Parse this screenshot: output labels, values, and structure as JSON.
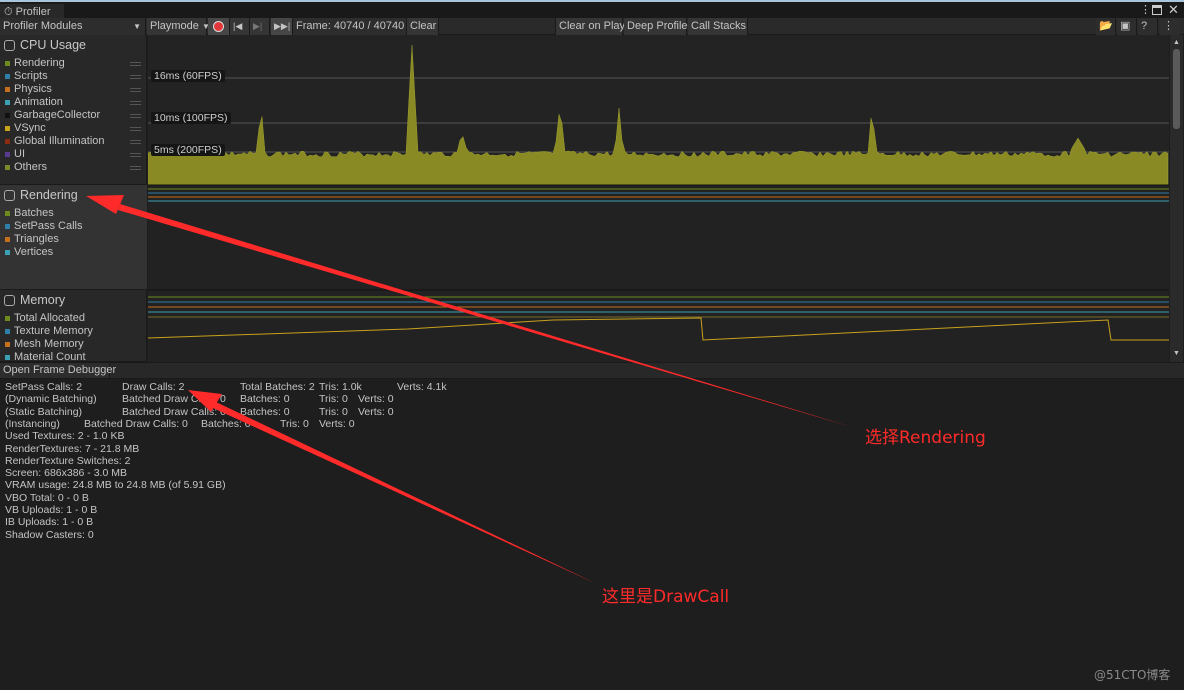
{
  "window": {
    "tab": "Profiler",
    "menu_icon": "kebab-icon",
    "maximize_icon": "maximize-icon",
    "close_icon": "close-icon"
  },
  "toolbar": {
    "modules": "Profiler Modules",
    "target": "Playmode",
    "frame": "Frame: 40740 / 40740",
    "clear": "Clear",
    "clear_on_play": "Clear on Play",
    "deep_profile": "Deep Profile",
    "call_stacks": "Call Stacks"
  },
  "modules": [
    {
      "title": "CPU Usage",
      "items": [
        {
          "label": "Rendering",
          "color": "#6e8a1c"
        },
        {
          "label": "Scripts",
          "color": "#2f7fa8"
        },
        {
          "label": "Physics",
          "color": "#c6701f"
        },
        {
          "label": "Animation",
          "color": "#3aa0b5"
        },
        {
          "label": "GarbageCollector",
          "color": "#111111"
        },
        {
          "label": "VSync",
          "color": "#c9a21b"
        },
        {
          "label": "Global Illumination",
          "color": "#8a2a10"
        },
        {
          "label": "UI",
          "color": "#5a3a8f"
        },
        {
          "label": "Others",
          "color": "#7a8a2a"
        }
      ]
    },
    {
      "title": "Rendering",
      "items": [
        {
          "label": "Batches",
          "color": "#6e8a1c"
        },
        {
          "label": "SetPass Calls",
          "color": "#2f7fa8"
        },
        {
          "label": "Triangles",
          "color": "#c6701f"
        },
        {
          "label": "Vertices",
          "color": "#3aa0b5"
        }
      ]
    },
    {
      "title": "Memory",
      "items": [
        {
          "label": "Total Allocated",
          "color": "#6e8a1c"
        },
        {
          "label": "Texture Memory",
          "color": "#2f7fa8"
        },
        {
          "label": "Mesh Memory",
          "color": "#c6701f"
        },
        {
          "label": "Material Count",
          "color": "#3aa0b5"
        }
      ]
    }
  ],
  "cpu_chart": {
    "lines": [
      "16ms (60FPS)",
      "10ms (100FPS)",
      "5ms (200FPS)"
    ],
    "fill_color": "#8a8a25"
  },
  "frame_debugger": "Open Frame Debugger",
  "stats": {
    "r1": [
      "SetPass Calls: 2",
      "Draw Calls: 2",
      "Total Batches: 2",
      "Tris: 1.0k",
      "Verts: 4.1k"
    ],
    "r2": [
      "(Dynamic Batching)",
      "Batched Draw Calls: 0",
      "Batches: 0",
      "Tris: 0",
      "Verts: 0"
    ],
    "r3": [
      "(Static Batching)",
      "Batched Draw Calls: 0",
      "Batches: 0",
      "Tris: 0",
      "Verts: 0"
    ],
    "r4": [
      "(Instancing)",
      "Batched Draw Calls: 0",
      "Batches: 0",
      "Tris: 0",
      "Verts: 0"
    ],
    "lines": [
      "Used Textures: 2 - 1.0 KB",
      "RenderTextures: 7 - 21.8 MB",
      "RenderTexture Switches: 2",
      "Screen: 686x386 - 3.0 MB",
      "VRAM usage: 24.8 MB to 24.8 MB (of 5.91 GB)",
      "VBO Total: 0 - 0 B",
      "VB Uploads: 1 - 0 B",
      "IB Uploads: 1 - 0 B",
      "Shadow Casters: 0"
    ]
  },
  "annotations": {
    "a1": "选择Rendering",
    "a2": "这里是DrawCall",
    "color": "#ff2a2a"
  },
  "watermark": "@51CTO博客"
}
